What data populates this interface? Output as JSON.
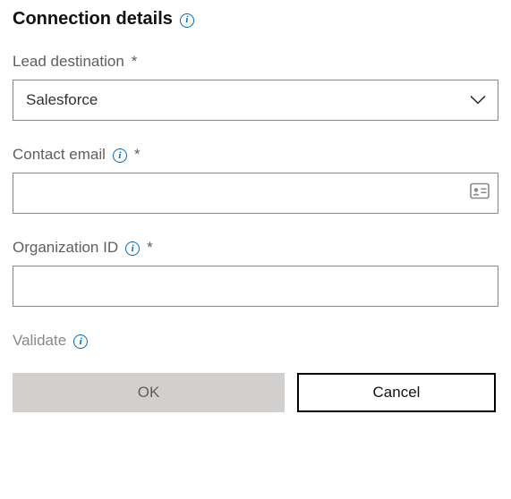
{
  "header": {
    "title": "Connection details"
  },
  "leadDestination": {
    "label": "Lead destination",
    "required": "*",
    "selected": "Salesforce"
  },
  "contactEmail": {
    "label": "Contact email",
    "required": "*",
    "value": ""
  },
  "organizationId": {
    "label": "Organization ID",
    "required": "*",
    "value": ""
  },
  "validate": {
    "label": "Validate"
  },
  "buttons": {
    "ok": "OK",
    "cancel": "Cancel"
  }
}
